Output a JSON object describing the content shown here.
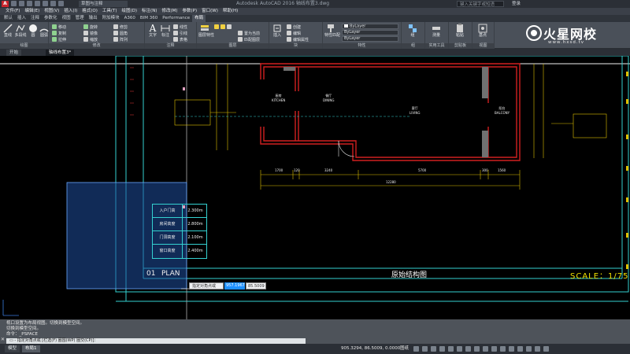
{
  "app": {
    "title_workspace": "草图与注释",
    "doc_title": "Autodesk AutoCAD 2016    轴线布置3.dwg",
    "search_placeholder": "键入关键字或短语",
    "user_label": "登录"
  },
  "menu": [
    "文件(F)",
    "编辑(E)",
    "视图(V)",
    "插入(I)",
    "格式(O)",
    "工具(T)",
    "绘图(D)",
    "标注(N)",
    "修改(M)",
    "参数(P)",
    "窗口(W)",
    "帮助(H)"
  ],
  "ribbon_tabs": [
    "默认",
    "插入",
    "注释",
    "参数化",
    "视图",
    "管理",
    "输出",
    "附加模块",
    "A360",
    "BIM 360",
    "Performance",
    "布局"
  ],
  "active_tab": "布局",
  "ribbon": {
    "draw": {
      "title": "绘图",
      "tools": [
        "直线",
        "多段线",
        "圆",
        "圆弧"
      ]
    },
    "modify": {
      "title": "修改",
      "tools": [
        "移动",
        "旋转",
        "修剪",
        "复制",
        "镜像",
        "圆角",
        "拉伸",
        "缩放",
        "阵列"
      ]
    },
    "annotation": {
      "title": "注释",
      "tools": [
        "文字",
        "标注",
        "线性",
        "引线",
        "表格"
      ]
    },
    "layers": {
      "title": "图层",
      "tools": [
        "图层特性",
        "置为当前",
        "匹配图层"
      ]
    },
    "block": {
      "title": "块",
      "tools": [
        "插入",
        "创建",
        "编辑",
        "编辑属性"
      ]
    },
    "properties": {
      "title": "特性",
      "tools": [
        "特性匹配"
      ],
      "layer_value": "ByLayer",
      "linetype_value": "ByLayer",
      "lineweight_value": "ByLayer"
    },
    "groups": {
      "title": "组",
      "tools": [
        "组"
      ]
    },
    "utilities": {
      "title": "实用工具",
      "tools": [
        "测量"
      ]
    },
    "clipboard": {
      "title": "剪贴板",
      "tools": [
        "粘贴"
      ]
    },
    "view": {
      "title": "视图",
      "tools": [
        "基点"
      ]
    }
  },
  "logo": {
    "name": "火星网校",
    "url_text": "www.hxsd.tv"
  },
  "file_tabs": [
    "开始",
    "轴线布置3*"
  ],
  "active_file_tab": "轴线布置3*",
  "drawing": {
    "rooms": [
      {
        "cn": "厨房",
        "en": "KITCHEN"
      },
      {
        "cn": "餐厅",
        "en": "DINING"
      },
      {
        "cn": "客厅",
        "en": "LIVING"
      },
      {
        "cn": "阳台",
        "en": "BALCONY"
      }
    ],
    "dimensions": [
      "1700",
      "120",
      "3240",
      "5700",
      "300",
      "1560"
    ],
    "total_dimension": "12280",
    "heights": [
      {
        "label": "入户门高",
        "value": "2.300m"
      },
      {
        "label": "房间高度",
        "value": "2.800m"
      },
      {
        "label": "门洞高度",
        "value": "2.100m"
      },
      {
        "label": "窗口高度",
        "value": "2.400m"
      }
    ],
    "title_number": "01",
    "title_plan": "PLAN",
    "title_name": "原始结构图",
    "scale": "SCALE：1/75"
  },
  "dynamic_input": {
    "prompt": "指定对角点或",
    "value1": "957.1967",
    "value2": "85.5009"
  },
  "command": {
    "history": [
      "视口设置为布局视图。切换到模型空间。",
      "切换到模型空间。",
      "命令：_PSPACE"
    ],
    "input_prompt": "▭ - 指定对角点或 [栏选(F) 圈围(WP) 圈交(CP)]："
  },
  "status": {
    "layout_tabs": [
      "模型",
      "布局1"
    ],
    "active_layout": "布局1",
    "coords": "905.3294, 86.5009, 0.0000",
    "space": "图纸"
  }
}
